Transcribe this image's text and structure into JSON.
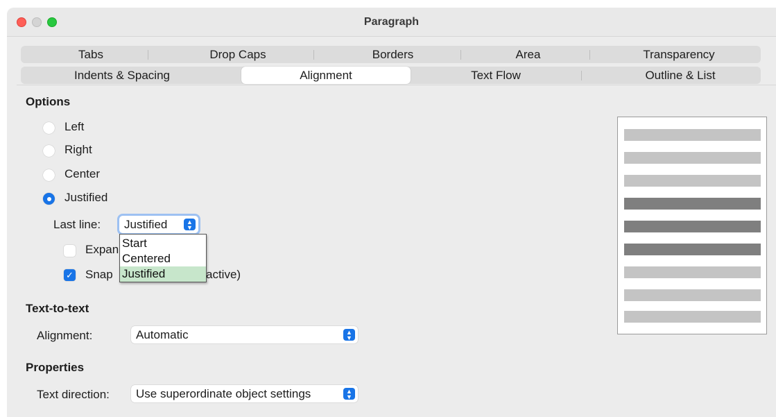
{
  "window": {
    "title": "Paragraph"
  },
  "tabs_row1": [
    "Tabs",
    "Drop Caps",
    "Borders",
    "Area",
    "Transparency"
  ],
  "tabs_row2": [
    "Indents & Spacing",
    "Alignment",
    "Text Flow",
    "Outline & List"
  ],
  "active_tab": "Alignment",
  "options": {
    "heading": "Options",
    "radios": [
      "Left",
      "Right",
      "Center",
      "Justified"
    ],
    "selected_radio": "Justified",
    "last_line_label": "Last line:",
    "last_line_value": "Justified",
    "last_line_options": [
      "Start",
      "Centered",
      "Justified"
    ],
    "expand_label_visible": "Expan",
    "expand_checked": false,
    "snap_label_left": "Snap",
    "snap_label_right": "active)",
    "snap_checked": true
  },
  "text_to_text": {
    "heading": "Text-to-text",
    "alignment_label": "Alignment:",
    "alignment_value": "Automatic"
  },
  "properties": {
    "heading": "Properties",
    "direction_label": "Text direction:",
    "direction_value": "Use superordinate object settings"
  },
  "colors": {
    "accent": "#1874e7",
    "selected_item": "#c7e6cb"
  }
}
